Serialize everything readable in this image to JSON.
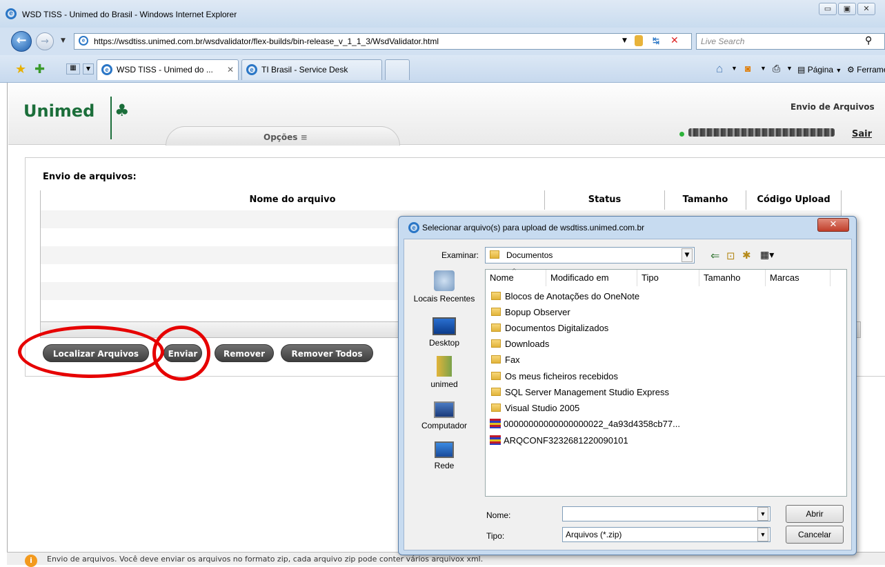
{
  "window": {
    "title": "WSD TISS - Unimed do Brasil - Windows Internet Explorer"
  },
  "address": {
    "url": "https://wsdtiss.unimed.com.br/wsdvalidator/flex-builds/bin-release_v_1_1_3/WsdValidator.html",
    "search_placeholder": "Live Search"
  },
  "tabs": [
    {
      "label": "WSD TISS - Unimed do ...",
      "active": true
    },
    {
      "label": "TI Brasil - Service Desk",
      "active": false
    }
  ],
  "toolbar": {
    "page_label": "Página",
    "tools_label": "Ferramentas"
  },
  "header": {
    "logo": "Unimed",
    "options_label": "Opções",
    "section_title": "Envio de Arquivos",
    "logout_label": "Sair"
  },
  "panel": {
    "title": "Envio de arquivos:",
    "columns": [
      "Nome do arquivo",
      "Status",
      "Tamanho",
      "Código Upload"
    ],
    "buttons": {
      "find": "Localizar Arquivos",
      "send": "Enviar",
      "remove": "Remover",
      "remove_all": "Remover Todos"
    }
  },
  "status_text": "Envio de arquivos. Você deve enviar os arquivos no formato zip, cada arquivo zip pode conter vários arquivox xml.",
  "dialog": {
    "title": "Selecionar arquivo(s) para upload de wsdtiss.unimed.com.br",
    "look_in_label": "Examinar:",
    "look_in_value": "Documentos",
    "places": [
      "Locais Recentes",
      "Desktop",
      "unimed",
      "Computador",
      "Rede"
    ],
    "columns": [
      "Nome",
      "Modificado em",
      "Tipo",
      "Tamanho",
      "Marcas"
    ],
    "files": [
      {
        "name": "Blocos de Anotações do OneNote",
        "kind": "folder"
      },
      {
        "name": "Bopup Observer",
        "kind": "folder"
      },
      {
        "name": "Documentos Digitalizados",
        "kind": "folder"
      },
      {
        "name": "Downloads",
        "kind": "folder"
      },
      {
        "name": "Fax",
        "kind": "folder"
      },
      {
        "name": "Os meus ficheiros recebidos",
        "kind": "folder"
      },
      {
        "name": "SQL Server Management Studio Express",
        "kind": "folder"
      },
      {
        "name": "Visual Studio 2005",
        "kind": "folder"
      },
      {
        "name": "00000000000000000022_4a93d4358cb77...",
        "kind": "zip"
      },
      {
        "name": "ARQCONF3232681220090101",
        "kind": "zip"
      }
    ],
    "name_label": "Nome:",
    "name_value": "",
    "type_label": "Tipo:",
    "type_value": "Arquivos (*.zip)",
    "open_label": "Abrir",
    "cancel_label": "Cancelar"
  }
}
